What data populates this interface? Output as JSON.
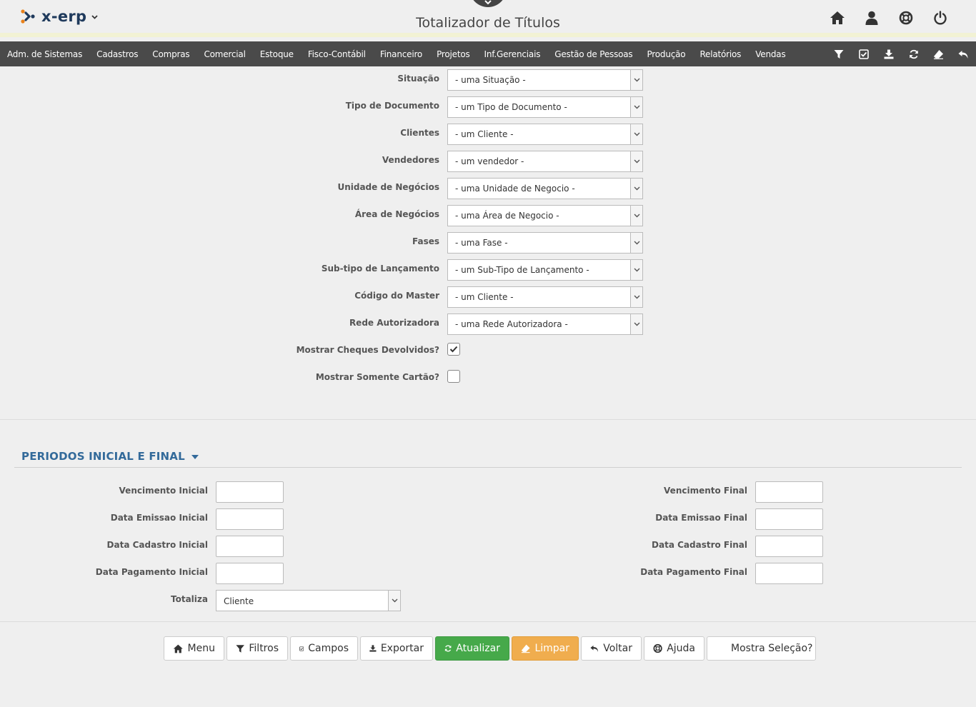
{
  "header": {
    "logo_text": "x-erp",
    "title": "Totalizador de Títulos"
  },
  "top_icons": [
    "home-icon",
    "user-icon",
    "lifebuoy-icon",
    "power-icon"
  ],
  "menubar": {
    "items": [
      "Adm. de Sistemas",
      "Cadastros",
      "Compras",
      "Comercial",
      "Estoque",
      "Fisco-Contábil",
      "Financeiro",
      "Projetos",
      "Inf.Gerenciais",
      "Gestão de Pessoas",
      "Produção",
      "Relatórios",
      "Vendas"
    ],
    "tools": [
      "filter-icon",
      "checkbox-icon",
      "download-icon",
      "refresh-icon",
      "eraser-icon",
      "undo-icon"
    ]
  },
  "filters": [
    {
      "label": "Situação",
      "value": "- uma Situação -"
    },
    {
      "label": "Tipo de Documento",
      "value": "- um Tipo de Documento -"
    },
    {
      "label": "Clientes",
      "value": "- um Cliente -"
    },
    {
      "label": "Vendedores",
      "value": "- um vendedor -"
    },
    {
      "label": "Unidade de Negócios",
      "value": "- uma Unidade de Negocio -"
    },
    {
      "label": "Área de Negócios",
      "value": "- uma Área de Negocio -"
    },
    {
      "label": "Fases",
      "value": "- uma Fase -"
    },
    {
      "label": "Sub-tipo de Lançamento",
      "value": "- um Sub-Tipo de Lançamento -"
    },
    {
      "label": "Código do Master",
      "value": "- um Cliente -"
    },
    {
      "label": "Rede Autorizadora",
      "value": "- uma Rede Autorizadora -"
    }
  ],
  "checks": [
    {
      "label": "Mostrar Cheques Devolvidos?",
      "checked": true
    },
    {
      "label": "Mostrar Somente Cartão?",
      "checked": false
    }
  ],
  "periods": {
    "section_title": "PERIODOS INICIAL E FINAL",
    "left": [
      "Vencimento Inicial",
      "Data Emissao Inicial",
      "Data Cadastro Inicial",
      "Data Pagamento Inicial"
    ],
    "right": [
      "Vencimento Final",
      "Data Emissao Final",
      "Data Cadastro Final",
      "Data Pagamento Final"
    ],
    "totaliza_label": "Totaliza",
    "totaliza_value": "Cliente"
  },
  "buttons": [
    {
      "label": "Menu",
      "icon": "home-icon"
    },
    {
      "label": "Filtros",
      "icon": "filter-icon"
    },
    {
      "label": "Campos",
      "icon": "checkbox-icon"
    },
    {
      "label": "Exportar",
      "icon": "download-icon"
    },
    {
      "label": "Atualizar",
      "icon": "refresh-icon"
    },
    {
      "label": "Limpar",
      "icon": "eraser-icon"
    },
    {
      "label": "Voltar",
      "icon": "undo-icon"
    },
    {
      "label": "Ajuda",
      "icon": "lifebuoy-icon"
    },
    {
      "label": "Mostra Seleção?",
      "icon": ""
    }
  ],
  "colors": {
    "menubar": "#4a4a4a",
    "section_title": "#336a9a",
    "btn_atualizar": "#46a94a",
    "btn_limpar": "#f0ad4e"
  }
}
